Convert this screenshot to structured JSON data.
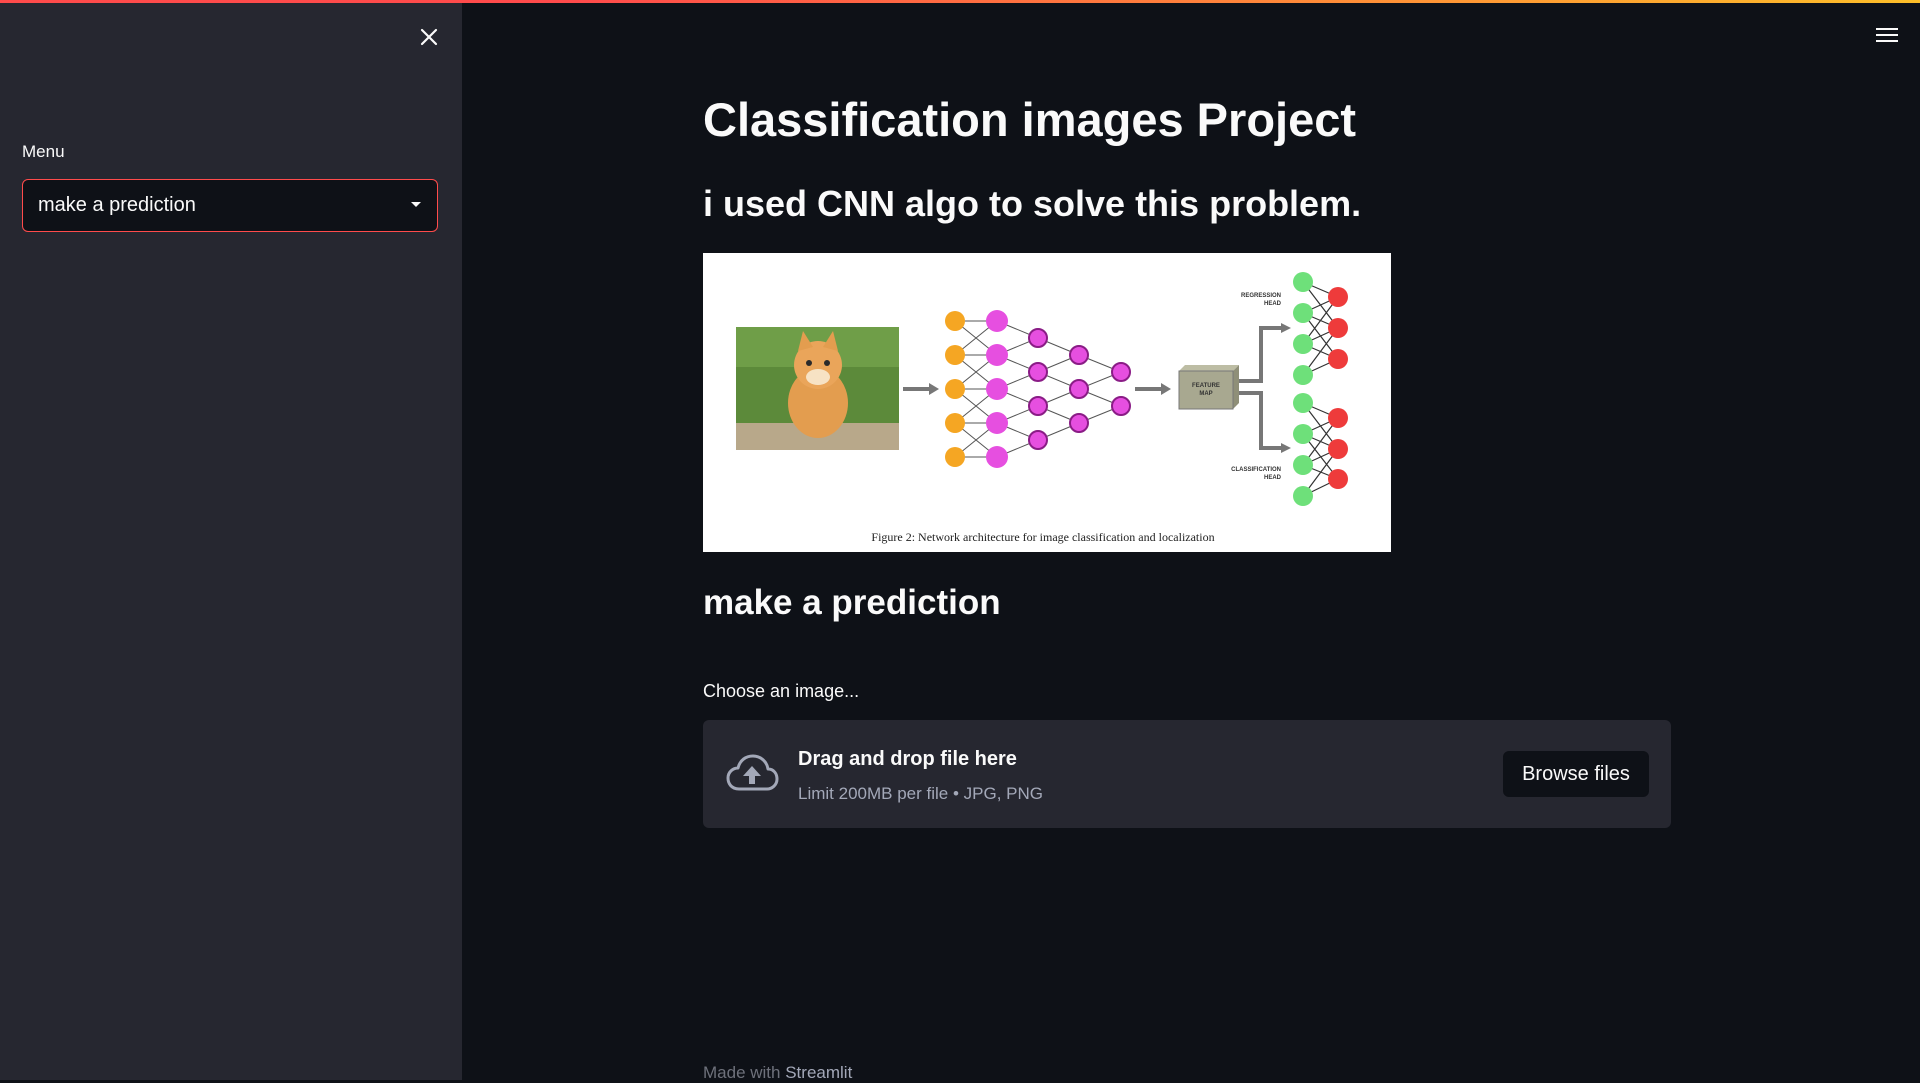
{
  "sidebar": {
    "close_icon": "close-icon",
    "menu_label": "Menu",
    "menu_value": "make a prediction",
    "caret_icon": "caret-down-icon"
  },
  "header": {
    "menu_icon": "hamburger-menu-icon"
  },
  "main": {
    "title": "Classification images Project",
    "subtitle": "i used CNN algo to solve this problem.",
    "figure": {
      "caption": "Figure 2: Network architecture for image classification and localization",
      "labels": {
        "regression_head_1": "REGRESSION",
        "regression_head_2": "HEAD",
        "feature_map_1": "FEATURE",
        "feature_map_2": "MAP",
        "classification_head_1": "CLASSIFICATION",
        "classification_head_2": "HEAD"
      }
    },
    "section_title": "make a prediction",
    "uploader": {
      "label": "Choose an image...",
      "icon": "cloud-upload-icon",
      "drop_text": "Drag and drop file here",
      "limit_text": "Limit 200MB per file • JPG, PNG",
      "browse_label": "Browse files"
    }
  },
  "footer": {
    "prefix": "Made with",
    "link": "Streamlit"
  },
  "colors": {
    "background": "#0e1117",
    "sidebar": "#262730",
    "accent": "#ff4b4b",
    "text": "#fafafa",
    "muted": "#a3a8b8"
  }
}
